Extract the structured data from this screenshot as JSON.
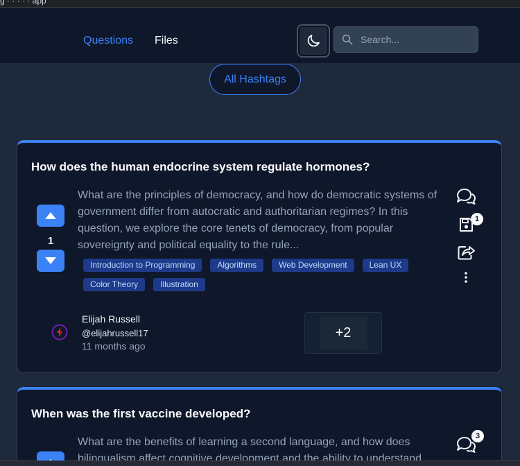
{
  "browser": {
    "tab_title": "g · · · · · app"
  },
  "nav": {
    "questions_label": "Questions",
    "files_label": "Files"
  },
  "search": {
    "placeholder": "Search..."
  },
  "hashtags": {
    "label": "All Hashtags"
  },
  "questions": [
    {
      "title": "How does the human endocrine system regulate hormones?",
      "votes": "1",
      "body": "What are the principles of democracy, and how do democratic systems of government differ from autocratic and authoritarian regimes? In this question, we explore the core tenets of democracy, from popular sovereignty and political equality to the rule...",
      "tags": [
        "Introduction to Programming",
        "Algorithms",
        "Web Development",
        "Lean UX",
        "Color Theory",
        "Illustration"
      ],
      "saved_count": "1",
      "author": {
        "name": "Elijah Russell",
        "handle": "@elijahrussell17",
        "time": "11 months ago"
      },
      "media_more": "+2"
    },
    {
      "title": "When was the first vaccine developed?",
      "body": "What are the benefits of learning a second language, and how does bilingualism affect cognitive development and the ability to understand",
      "comment_count": "3"
    }
  ],
  "colors": {
    "accent": "#3b82f6",
    "card_bg": "#0f172a",
    "page_bg": "#1e293b",
    "tag_bg": "#1e3a8a"
  },
  "icons": [
    "moon-icon",
    "search-icon",
    "arrow-up-icon",
    "arrow-down-icon",
    "comments-icon",
    "save-icon",
    "share-icon",
    "more-vertical-icon",
    "lightning-icon"
  ]
}
